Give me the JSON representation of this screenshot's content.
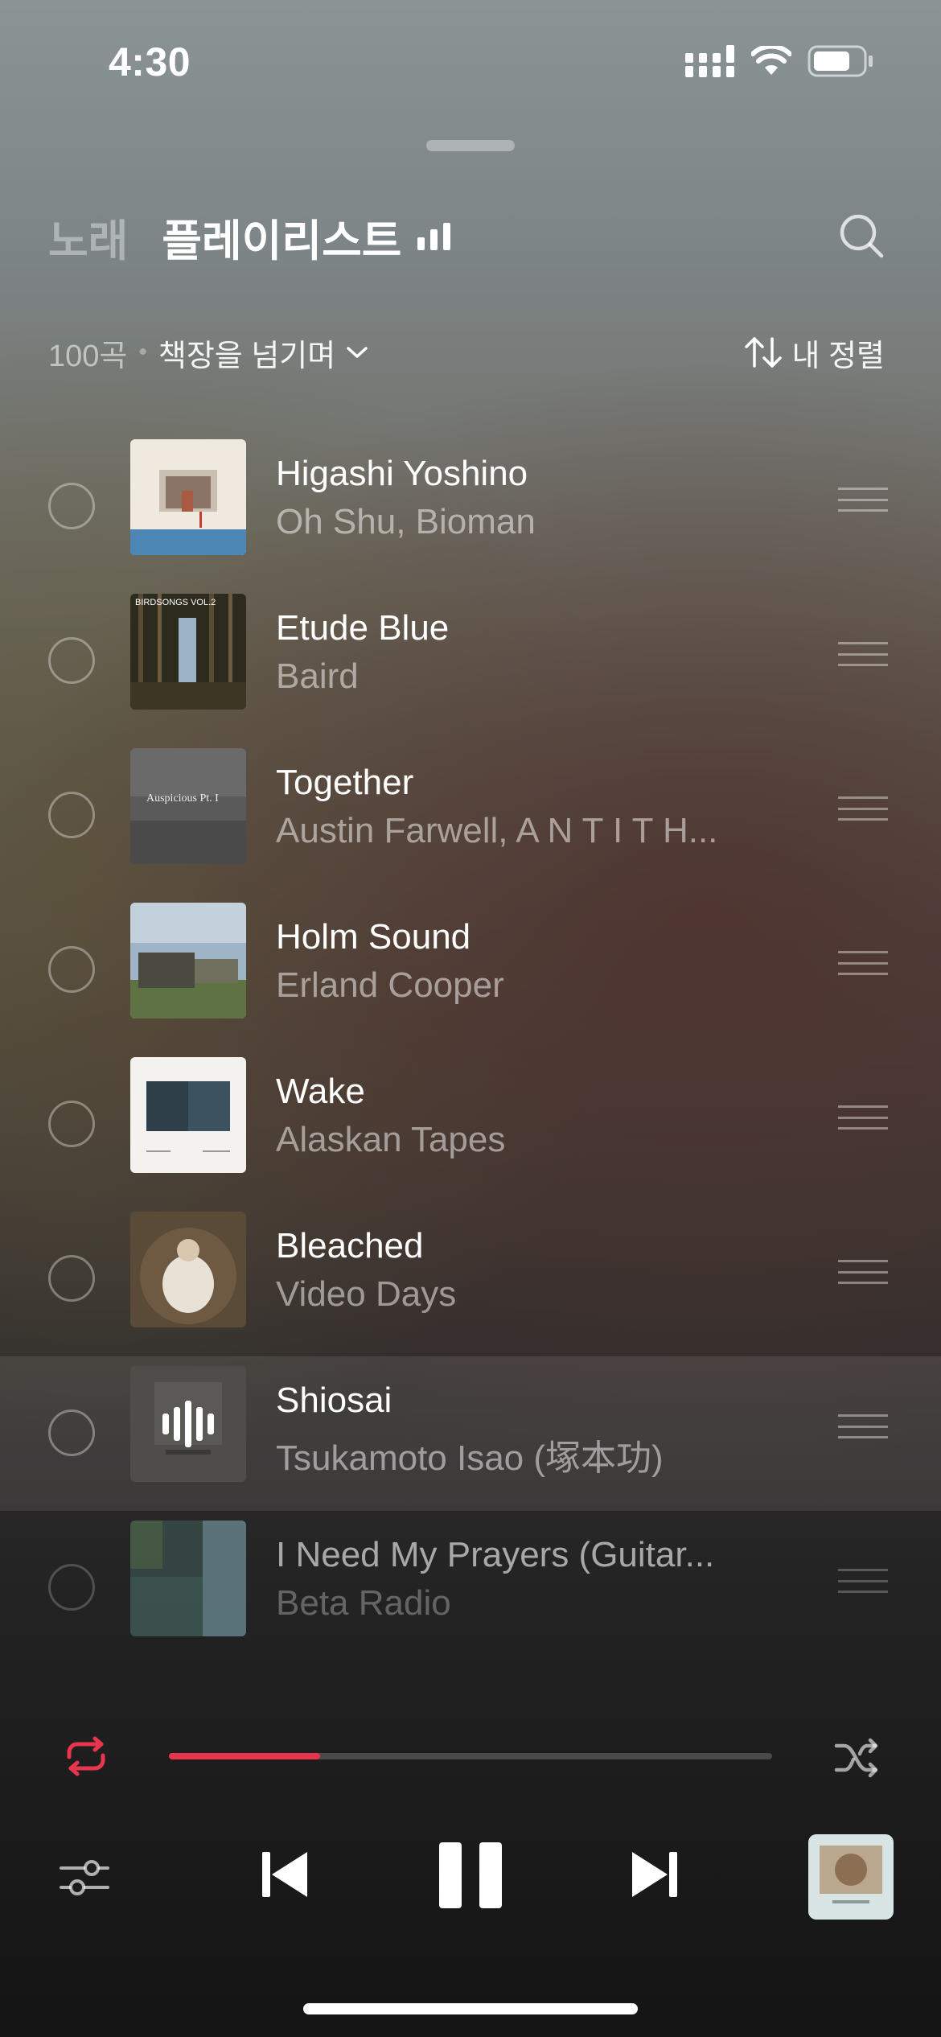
{
  "status_bar": {
    "time": "4:30"
  },
  "header": {
    "tab_songs": "노래",
    "tab_playlist": "플레이리스트"
  },
  "subheader": {
    "count": "100곡",
    "separator": "•",
    "playlist_name": "책장을 넘기며",
    "sort_label": "내 정렬"
  },
  "tracks": [
    {
      "title": "Higashi Yoshino",
      "artist": "Oh Shu, Bioman"
    },
    {
      "title": "Etude Blue",
      "artist": "Baird"
    },
    {
      "title": "Together",
      "artist": "Austin Farwell, A N T I T H..."
    },
    {
      "title": "Holm Sound",
      "artist": "Erland Cooper"
    },
    {
      "title": "Wake",
      "artist": "Alaskan Tapes"
    },
    {
      "title": "Bleached",
      "artist": "Video Days"
    },
    {
      "title": "Shiosai",
      "artist": "Tsukamoto Isao (塚本功)"
    },
    {
      "title": "I Need My Prayers (Guitar...",
      "artist": "Beta Radio"
    }
  ],
  "album_art_text": {
    "etude_blue": "BIRDSONGS VOL.2",
    "together": "Auspicious Pt. I"
  },
  "now_playing_index": 6,
  "player": {
    "progress": 0.25
  },
  "colors": {
    "accent": "#e8354e"
  },
  "icons": [
    "signal-icon",
    "wifi-icon",
    "battery-icon",
    "search-icon",
    "chevron-down-icon",
    "sort-icon",
    "drag-handle-icon",
    "repeat-icon",
    "shuffle-icon",
    "equalizer-icon",
    "previous-icon",
    "pause-icon",
    "next-icon"
  ]
}
